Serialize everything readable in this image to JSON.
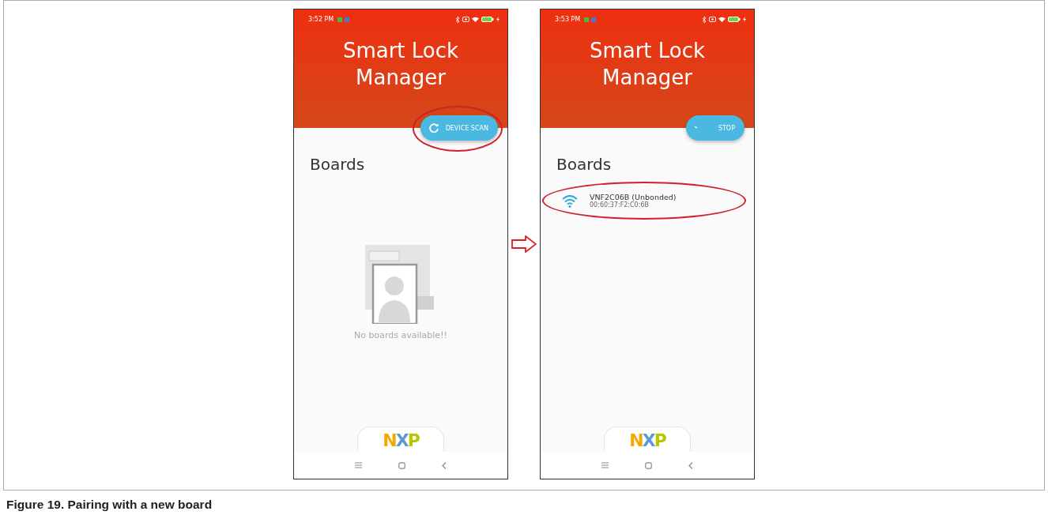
{
  "screens": [
    {
      "status_time": "3:52 PM",
      "app_title": "Smart Lock Manager",
      "scan_button": {
        "kind": "scan",
        "label": "DEVICE SCAN",
        "circled": true
      },
      "section_title": "Boards",
      "empty_message": "No boards available!!",
      "logo": "NXP"
    },
    {
      "status_time": "3:53 PM",
      "app_title": "Smart Lock Manager",
      "scan_button": {
        "kind": "stop",
        "label": "STOP",
        "circled": false
      },
      "section_title": "Boards",
      "boards": [
        {
          "name": "VNF2C06B (Unbonded)",
          "address": "00:60:37:F2:C0:6B",
          "circled": true
        }
      ],
      "logo": "NXP"
    }
  ],
  "caption": "Figure 19.  Pairing with a new board"
}
